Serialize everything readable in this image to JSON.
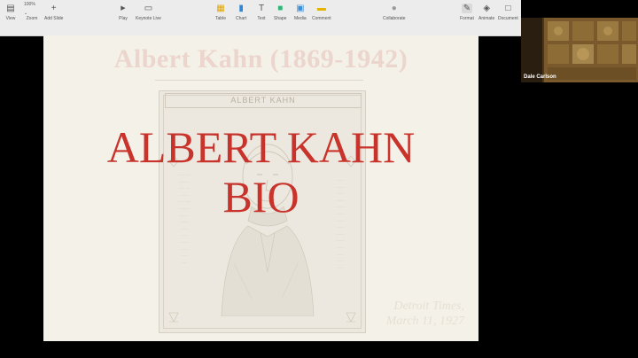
{
  "toolbar": {
    "items": [
      {
        "label": "View",
        "icon": "sidebar-icon",
        "glyph": "▤"
      },
      {
        "label": "Zoom",
        "icon": "zoom-icon",
        "glyph": "100% ⌄"
      },
      {
        "label": "Add Slide",
        "icon": "plus-icon",
        "glyph": "+"
      },
      {
        "label": "Play",
        "icon": "play-icon",
        "glyph": "▶"
      },
      {
        "label": "Keynote Live",
        "icon": "keynote-live-icon",
        "glyph": "▭"
      },
      {
        "label": "Table",
        "icon": "table-icon",
        "glyph": "▦"
      },
      {
        "label": "Chart",
        "icon": "chart-icon",
        "glyph": "▮"
      },
      {
        "label": "Text",
        "icon": "text-icon",
        "glyph": "T"
      },
      {
        "label": "Shape",
        "icon": "shape-icon",
        "glyph": "■"
      },
      {
        "label": "Media",
        "icon": "media-icon",
        "glyph": "▣"
      },
      {
        "label": "Comment",
        "icon": "comment-icon",
        "glyph": "▬"
      },
      {
        "label": "Collaborate",
        "icon": "collaborate-icon",
        "glyph": "●"
      },
      {
        "label": "Format",
        "icon": "format-icon",
        "glyph": "✎"
      },
      {
        "label": "Animate",
        "icon": "animate-icon",
        "glyph": "◈"
      },
      {
        "label": "Document",
        "icon": "document-icon",
        "glyph": "□"
      }
    ],
    "zoom_value": "100%"
  },
  "slide": {
    "background_title": "Albert Kahn (1869-1942)",
    "poster_name": "ALBERT KAHN",
    "poster_left_text": "........ ....\n......... ..\n....... ....\n..........\n....... ......\n...........\n........ ...\n...........\n.........\n......\n.........\n......\n........\n.....",
    "poster_right_text": ".......\n.........\n........\n..........\n.........\n..........\n.........\n.........\n..........\n.........\n.......\n........\n......\n........",
    "script_text": "Detroit Times,\nMarch 11, 1927",
    "title_line1": "ALBERT KAHN",
    "title_line2": "BIO"
  },
  "participant": {
    "name": "Dale Carlson"
  },
  "colors": {
    "title_red": "#c8332b",
    "toolbar_bg": "#ececec",
    "slide_bg": "#f4f1e9"
  }
}
